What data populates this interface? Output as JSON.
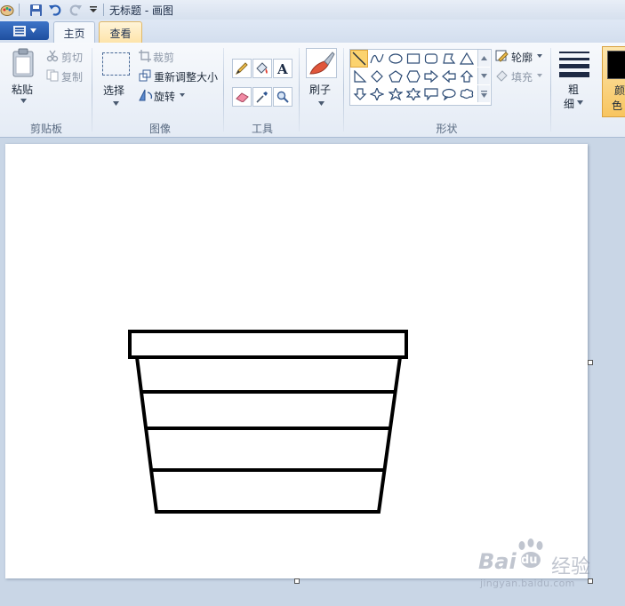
{
  "titlebar": {
    "title": "无标题 - 画图"
  },
  "tabs": [
    {
      "label": "主页"
    },
    {
      "label": "查看"
    }
  ],
  "clipboard": {
    "paste": "粘贴",
    "cut": "剪切",
    "copy": "复制",
    "group": "剪贴板"
  },
  "image": {
    "select": "选择",
    "crop": "裁剪",
    "resize": "重新调整大小",
    "rotate": "旋转",
    "group": "图像"
  },
  "tools": {
    "group": "工具"
  },
  "brushes": {
    "label": "刷子"
  },
  "shapes": {
    "outline": "轮廓",
    "fill": "填充",
    "group": "形状"
  },
  "size": {
    "line1": "粗",
    "line2": "细"
  },
  "colors": {
    "label1": "颜",
    "label2": "色",
    "color1": "#000000"
  },
  "watermark": {
    "brand": "Bai",
    "brand2": "du",
    "sub": "经验",
    "url": "jingyan.baidu.com"
  }
}
